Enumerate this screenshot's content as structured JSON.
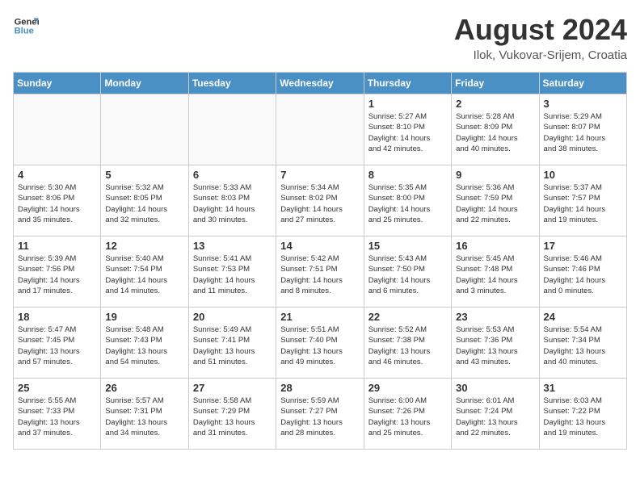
{
  "header": {
    "logo_line1": "General",
    "logo_line2": "Blue",
    "month_title": "August 2024",
    "location": "Ilok, Vukovar-Srijem, Croatia"
  },
  "weekdays": [
    "Sunday",
    "Monday",
    "Tuesday",
    "Wednesday",
    "Thursday",
    "Friday",
    "Saturday"
  ],
  "weeks": [
    [
      {
        "day": "",
        "info": ""
      },
      {
        "day": "",
        "info": ""
      },
      {
        "day": "",
        "info": ""
      },
      {
        "day": "",
        "info": ""
      },
      {
        "day": "1",
        "info": "Sunrise: 5:27 AM\nSunset: 8:10 PM\nDaylight: 14 hours\nand 42 minutes."
      },
      {
        "day": "2",
        "info": "Sunrise: 5:28 AM\nSunset: 8:09 PM\nDaylight: 14 hours\nand 40 minutes."
      },
      {
        "day": "3",
        "info": "Sunrise: 5:29 AM\nSunset: 8:07 PM\nDaylight: 14 hours\nand 38 minutes."
      }
    ],
    [
      {
        "day": "4",
        "info": "Sunrise: 5:30 AM\nSunset: 8:06 PM\nDaylight: 14 hours\nand 35 minutes."
      },
      {
        "day": "5",
        "info": "Sunrise: 5:32 AM\nSunset: 8:05 PM\nDaylight: 14 hours\nand 32 minutes."
      },
      {
        "day": "6",
        "info": "Sunrise: 5:33 AM\nSunset: 8:03 PM\nDaylight: 14 hours\nand 30 minutes."
      },
      {
        "day": "7",
        "info": "Sunrise: 5:34 AM\nSunset: 8:02 PM\nDaylight: 14 hours\nand 27 minutes."
      },
      {
        "day": "8",
        "info": "Sunrise: 5:35 AM\nSunset: 8:00 PM\nDaylight: 14 hours\nand 25 minutes."
      },
      {
        "day": "9",
        "info": "Sunrise: 5:36 AM\nSunset: 7:59 PM\nDaylight: 14 hours\nand 22 minutes."
      },
      {
        "day": "10",
        "info": "Sunrise: 5:37 AM\nSunset: 7:57 PM\nDaylight: 14 hours\nand 19 minutes."
      }
    ],
    [
      {
        "day": "11",
        "info": "Sunrise: 5:39 AM\nSunset: 7:56 PM\nDaylight: 14 hours\nand 17 minutes."
      },
      {
        "day": "12",
        "info": "Sunrise: 5:40 AM\nSunset: 7:54 PM\nDaylight: 14 hours\nand 14 minutes."
      },
      {
        "day": "13",
        "info": "Sunrise: 5:41 AM\nSunset: 7:53 PM\nDaylight: 14 hours\nand 11 minutes."
      },
      {
        "day": "14",
        "info": "Sunrise: 5:42 AM\nSunset: 7:51 PM\nDaylight: 14 hours\nand 8 minutes."
      },
      {
        "day": "15",
        "info": "Sunrise: 5:43 AM\nSunset: 7:50 PM\nDaylight: 14 hours\nand 6 minutes."
      },
      {
        "day": "16",
        "info": "Sunrise: 5:45 AM\nSunset: 7:48 PM\nDaylight: 14 hours\nand 3 minutes."
      },
      {
        "day": "17",
        "info": "Sunrise: 5:46 AM\nSunset: 7:46 PM\nDaylight: 14 hours\nand 0 minutes."
      }
    ],
    [
      {
        "day": "18",
        "info": "Sunrise: 5:47 AM\nSunset: 7:45 PM\nDaylight: 13 hours\nand 57 minutes."
      },
      {
        "day": "19",
        "info": "Sunrise: 5:48 AM\nSunset: 7:43 PM\nDaylight: 13 hours\nand 54 minutes."
      },
      {
        "day": "20",
        "info": "Sunrise: 5:49 AM\nSunset: 7:41 PM\nDaylight: 13 hours\nand 51 minutes."
      },
      {
        "day": "21",
        "info": "Sunrise: 5:51 AM\nSunset: 7:40 PM\nDaylight: 13 hours\nand 49 minutes."
      },
      {
        "day": "22",
        "info": "Sunrise: 5:52 AM\nSunset: 7:38 PM\nDaylight: 13 hours\nand 46 minutes."
      },
      {
        "day": "23",
        "info": "Sunrise: 5:53 AM\nSunset: 7:36 PM\nDaylight: 13 hours\nand 43 minutes."
      },
      {
        "day": "24",
        "info": "Sunrise: 5:54 AM\nSunset: 7:34 PM\nDaylight: 13 hours\nand 40 minutes."
      }
    ],
    [
      {
        "day": "25",
        "info": "Sunrise: 5:55 AM\nSunset: 7:33 PM\nDaylight: 13 hours\nand 37 minutes."
      },
      {
        "day": "26",
        "info": "Sunrise: 5:57 AM\nSunset: 7:31 PM\nDaylight: 13 hours\nand 34 minutes."
      },
      {
        "day": "27",
        "info": "Sunrise: 5:58 AM\nSunset: 7:29 PM\nDaylight: 13 hours\nand 31 minutes."
      },
      {
        "day": "28",
        "info": "Sunrise: 5:59 AM\nSunset: 7:27 PM\nDaylight: 13 hours\nand 28 minutes."
      },
      {
        "day": "29",
        "info": "Sunrise: 6:00 AM\nSunset: 7:26 PM\nDaylight: 13 hours\nand 25 minutes."
      },
      {
        "day": "30",
        "info": "Sunrise: 6:01 AM\nSunset: 7:24 PM\nDaylight: 13 hours\nand 22 minutes."
      },
      {
        "day": "31",
        "info": "Sunrise: 6:03 AM\nSunset: 7:22 PM\nDaylight: 13 hours\nand 19 minutes."
      }
    ]
  ]
}
